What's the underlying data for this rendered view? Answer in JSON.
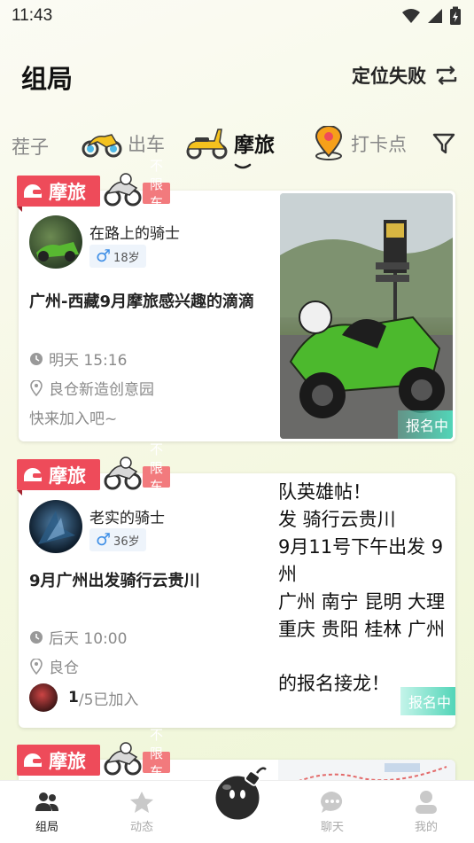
{
  "status": {
    "time": "11:43"
  },
  "header": {
    "title": "组局",
    "location_label": "定位失败"
  },
  "categories": [
    {
      "label": "茬子"
    },
    {
      "label": "出车"
    },
    {
      "label": "摩旅"
    },
    {
      "label": "打卡点"
    }
  ],
  "cards": [
    {
      "type_tag": "摩旅",
      "vehicle_tag": "不限车辆",
      "username": "在路上的骑士",
      "gender": "♂",
      "age": "18岁",
      "title": "广州-西藏9月摩旅感兴趣的滴滴",
      "time": "明天 15:16",
      "location": "良仓新造创意园",
      "extra": "快来加入吧~",
      "status": "报名中"
    },
    {
      "type_tag": "摩旅",
      "vehicle_tag": "不限车辆",
      "username": "老实的骑士",
      "gender": "♂",
      "age": "36岁",
      "title": "9月广州出发骑行云贵川",
      "time": "后天 10:00",
      "location": "良仓",
      "joined_current": "1",
      "joined_total": "/5已加入",
      "status": "报名中",
      "poster_lines": [
        "队英雄帖！",
        "发 骑行云贵川",
        "9月11号下午出发 9",
        "州",
        "广州 南宁 昆明 大理",
        "重庆 贵阳 桂林 广州",
        "的报名接龙！"
      ]
    },
    {
      "type_tag": "摩旅",
      "vehicle_tag": "不限车辆"
    }
  ],
  "nav": [
    {
      "label": "组局"
    },
    {
      "label": "动态"
    },
    {
      "label": "聊天"
    },
    {
      "label": "我的"
    }
  ],
  "colors": {
    "accent": "#ee4b5a",
    "open_badge": "#52d5b8",
    "gender_male": "#3d8ee6"
  }
}
